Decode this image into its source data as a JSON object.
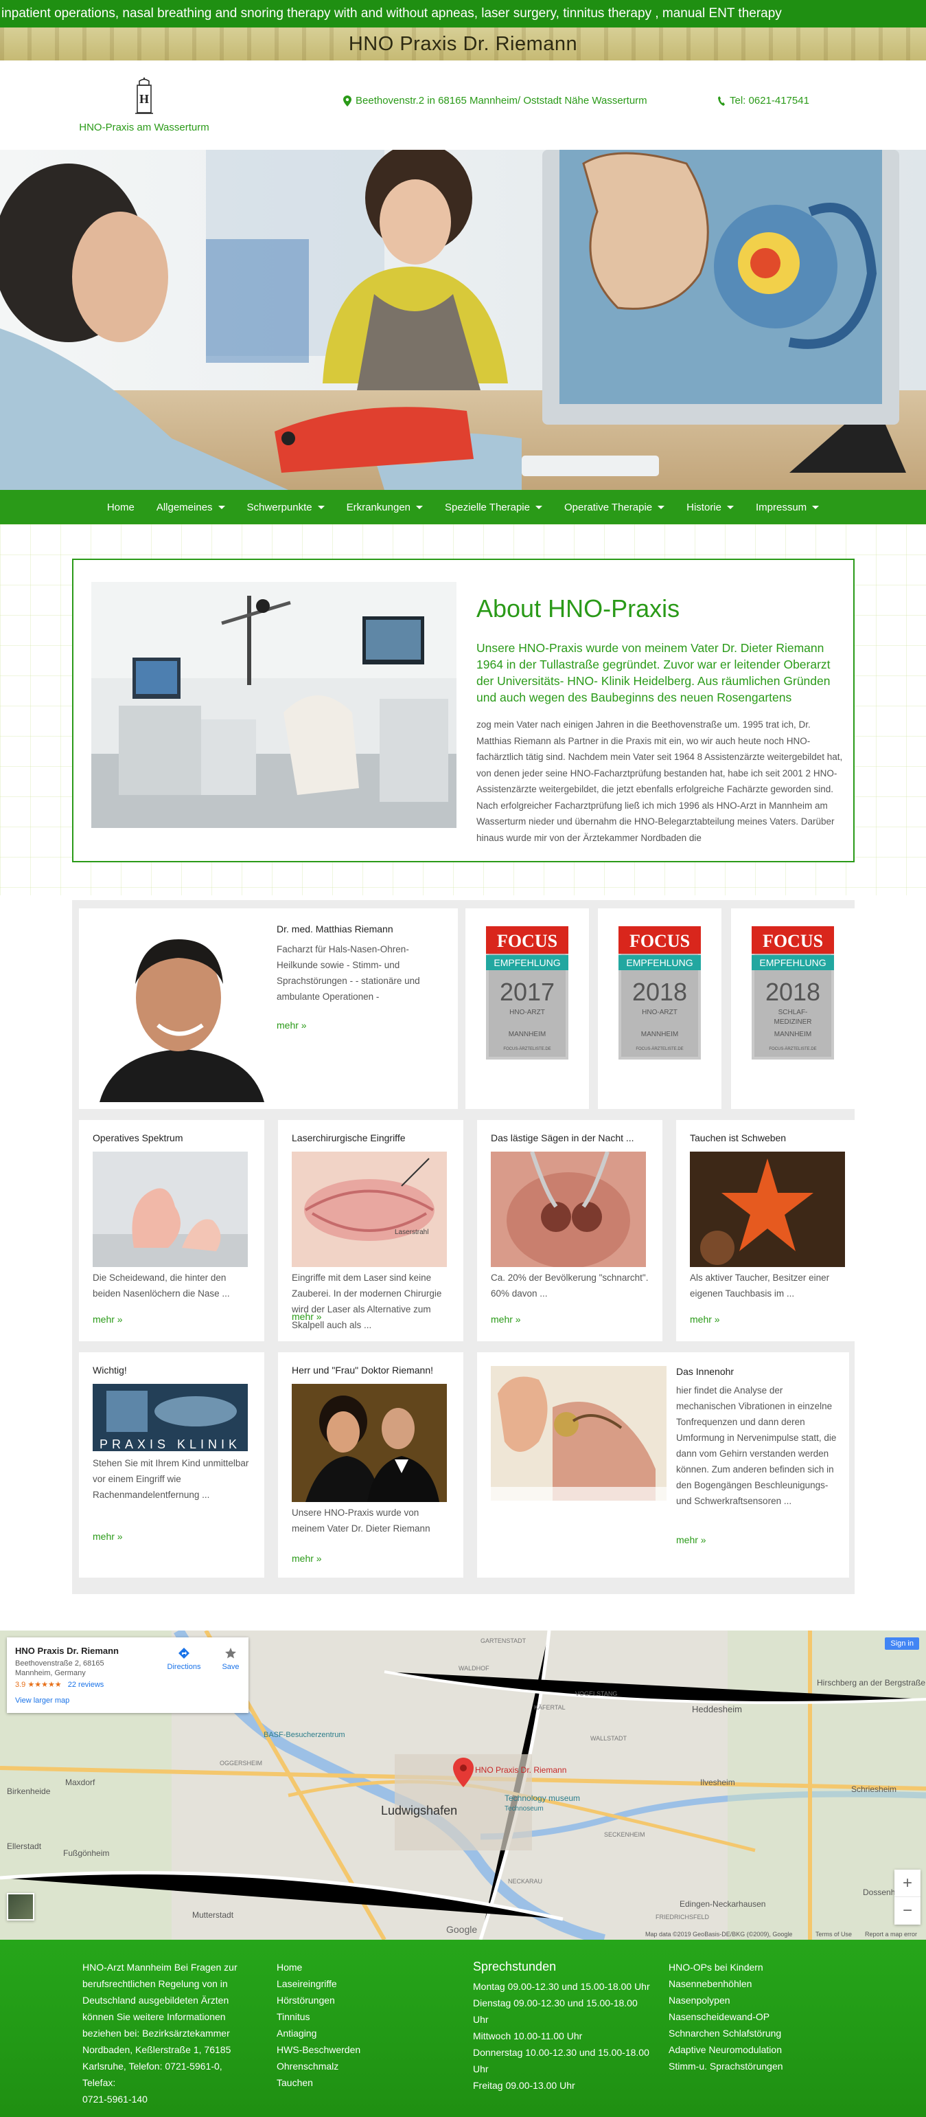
{
  "ticker": "inpatient operations, nasal breathing and snoring therapy with and without apneas, laser surgery, tinnitus therapy , manual ENT therapy",
  "banner_title": "HNO Praxis Dr. Riemann",
  "logo": {
    "letter": "H",
    "label": "HNO-Praxis am Wasserturm"
  },
  "contact": {
    "address": "Beethovenstr.2 in 68165 Mannheim/ Oststadt Nähe Wasserturm",
    "phone": "Tel: 0621-417541"
  },
  "nav": [
    {
      "label": "Home",
      "has_caret": false
    },
    {
      "label": "Allgemeines",
      "has_caret": true
    },
    {
      "label": "Schwerpunkte",
      "has_caret": true
    },
    {
      "label": "Erkrankungen",
      "has_caret": true
    },
    {
      "label": "Spezielle Therapie",
      "has_caret": true
    },
    {
      "label": "Operative Therapie",
      "has_caret": true
    },
    {
      "label": "Historie",
      "has_caret": true
    },
    {
      "label": "Impressum",
      "has_caret": true
    }
  ],
  "about": {
    "title": "About HNO-Praxis",
    "lead": "Unsere HNO-Praxis wurde von meinem Vater Dr. Dieter Riemann 1964 in der Tullastraße gegründet. Zuvor war er leitender Oberarzt der Universitäts- HNO- Klinik Heidelberg. Aus räumlichen Gründen und auch wegen des Baubeginns des neuen Rosengartens",
    "body": "zog mein Vater nach einigen Jahren in die Beethovenstraße um. 1995 trat ich, Dr. Matthias Riemann als Partner in die Praxis mit ein, wo wir auch heute noch HNO-fachärztlich tätig sind. Nachdem mein Vater seit 1964 8 Assistenzärzte weitergebildet hat, von denen jeder seine HNO-Facharztprüfung bestanden hat, habe ich seit 2001 2 HNO-Assistenzärzte weitergebildet, die jetzt ebenfalls erfolgreiche Fachärzte geworden sind. Nach erfolgreicher Facharztprüfung ließ ich mich 1996 als HNO-Arzt in Mannheim am Wasserturm nieder und übernahm die HNO-Belegarztabteilung meines Vaters. Darüber hinaus wurde mir von der Ärztekammer Nordbaden die"
  },
  "doctor": {
    "name": "Dr. med. Matthias Riemann",
    "text": "Facharzt für Hals-Nasen-Ohren-Heilkunde sowie - Stimm- und Sprachstörungen - - stationäre und ambulante Operationen -",
    "more": "mehr »"
  },
  "focus_badges": [
    {
      "brand": "FOCUS",
      "ribbon": "EMPFEHLUNG",
      "year": "2017",
      "line1": "HNO-ARZT",
      "line2": "",
      "city": "MANNHEIM",
      "foot": "FOCUS-ÄRZTELISTE.DE"
    },
    {
      "brand": "FOCUS",
      "ribbon": "EMPFEHLUNG",
      "year": "2018",
      "line1": "HNO-ARZT",
      "line2": "",
      "city": "MANNHEIM",
      "foot": "FOCUS-ÄRZTELISTE.DE"
    },
    {
      "brand": "FOCUS",
      "ribbon": "EMPFEHLUNG",
      "year": "2018",
      "line1": "SCHLAF-",
      "line2": "MEDIZINER",
      "city": "MANNHEIM",
      "foot": "FOCUS-ÄRZTELISTE.DE"
    }
  ],
  "cards_row2": [
    {
      "title": "Operatives Spektrum",
      "text": "Die Scheidewand, die hinter den beiden Nasenlöchern die Nase ...",
      "more": "mehr »"
    },
    {
      "title": "Laserchirurgische Eingriffe",
      "text": "Eingriffe mit dem Laser sind keine Zauberei. In der modernen Chirurgie wird der Laser als Alternative zum Skalpell auch als ...",
      "more": "mehr »",
      "img_label": "Laserstrahl"
    },
    {
      "title": "Das lästige Sägen in der Nacht ...",
      "text": "Ca. 20% der Bevölkerung \"schnarcht\". 60% davon ...",
      "more": "mehr »"
    },
    {
      "title": "Tauchen ist Schweben",
      "text": "Als aktiver Taucher, Besitzer einer eigenen Tauchbasis im ...",
      "more": "mehr »"
    }
  ],
  "cards_row3": [
    {
      "title": "Wichtig!",
      "text": "Stehen Sie mit Ihrem Kind unmittelbar vor einem Eingriff wie Rachenmandelentfernung ...",
      "more": "mehr »",
      "img_label": "PRAXIS KLINIK"
    },
    {
      "title": "Herr und \"Frau\" Doktor Riemann!",
      "text": "Unsere HNO-Praxis wurde von meinem Vater Dr. Dieter Riemann",
      "more": "mehr »"
    },
    {
      "title": "Das Innenohr",
      "text": "hier findet die Analyse der mechanischen Vibrationen in einzelne Tonfrequenzen und dann deren Umformung in Nervenimpulse statt, die dann vom Gehirn verstanden werden können. Zum anderen befinden sich in den Bogengängen Beschleunigungs- und Schwerkraftsensoren ...",
      "more": "mehr »"
    }
  ],
  "map": {
    "place": "HNO Praxis Dr. Riemann",
    "address1": "Beethovenstraße 2, 68165",
    "address2": "Mannheim, Germany",
    "rating": "3.9",
    "stars": "★★★★★",
    "reviews": "22 reviews",
    "larger": "View larger map",
    "directions": "Directions",
    "save": "Save",
    "sign_in": "Sign in",
    "pin_label": "HNO Praxis Dr. Riemann",
    "labels": {
      "ludwigshafen": "Ludwigshafen",
      "mannheim_label": "Technology museum",
      "mannheim_sub": "Technoseum",
      "heddesheim": "Heddesheim",
      "hirschberg": "Hirschberg an der Bergstraße",
      "ilvesheim": "Ilvesheim",
      "schriesheim": "Schriesheim",
      "birkenheide": "Birkenheide",
      "maxdorf": "Maxdorf",
      "ellerstadt": "Ellerstadt",
      "fussgoenheim": "Fußgönheim",
      "mutterstadt": "Mutterstadt",
      "edingen": "Edingen-Neckarhausen",
      "dossenheim": "Dossenheim",
      "basf": "BASF-Besucherzentrum",
      "neckarau": "NECKARAU",
      "wallstadt": "WALLSTADT",
      "vogelstang": "VOGELSTANG",
      "seckenheim": "SECKENHEIM",
      "friedrichsfeld": "FRIEDRICHSFELD",
      "oggersheim": "OGGERSHEIM",
      "gartenstadt": "GARTENSTADT",
      "waldhof": "WALDHOF",
      "kafertal": "KÄFERTAL"
    },
    "footer": "Map data ©2019 GeoBasis-DE/BKG (©2009), Google",
    "terms": "Terms of Use",
    "report": "Report a map error",
    "google": "Google",
    "zoom_in": "+",
    "zoom_out": "−"
  },
  "footer": {
    "col1": [
      "HNO-Arzt Mannheim Bei Fragen zur",
      "berufsrechtlichen Regelung von in",
      "Deutschland ausgebildeten Ärzten",
      "können Sie weitere Informationen",
      "beziehen bei: Bezirksärztekammer",
      "Nordbaden, Keßlerstraße 1, 76185",
      "Karlsruhe, Telefon: 0721-5961-0, Telefax:",
      "0721-5961-140"
    ],
    "col2": [
      "Home",
      "Laseireingriffe",
      "Hörstörungen",
      "Tinnitus",
      "Antiaging",
      "HWS-Beschwerden",
      "Ohrenschmalz",
      "Tauchen"
    ],
    "col3_title": "Sprechstunden",
    "col3": [
      "Montag 09.00-12.30 und 15.00-18.00 Uhr",
      "Dienstag 09.00-12.30 und 15.00-18.00",
      "Uhr",
      "Mittwoch 10.00-11.00 Uhr",
      "Donnerstag 10.00-12.30 und 15.00-18.00",
      "Uhr",
      "Freitag 09.00-13.00 Uhr"
    ],
    "col4": [
      "HNO-OPs bei Kindern",
      "Nasennebenhöhlen",
      "Nasenpolypen",
      "Nasenscheidewand-OP",
      "Schnarchen Schlafstörung",
      "Adaptive Neuromodulation",
      "Stimm-u. Sprachstörungen"
    ]
  }
}
